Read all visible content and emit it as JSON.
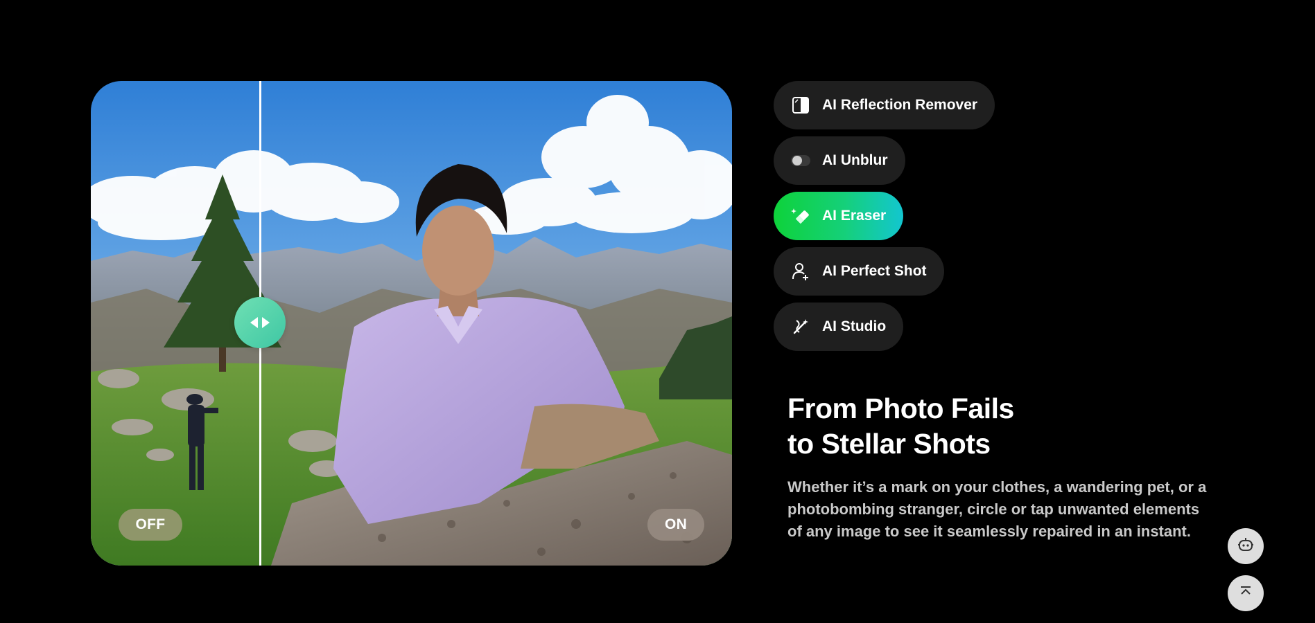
{
  "compare": {
    "off_label": "OFF",
    "on_label": "ON",
    "handle_icon": "left-right-arrows-icon",
    "handle_color": "#4fd3a9"
  },
  "features": [
    {
      "label": "AI Reflection Remover",
      "icon": "reflection-remover-icon",
      "active": false
    },
    {
      "label": "AI Unblur",
      "icon": "unblur-toggle-icon",
      "active": false
    },
    {
      "label": "AI Eraser",
      "icon": "eraser-icon",
      "active": true
    },
    {
      "label": "AI Perfect Shot",
      "icon": "person-plus-icon",
      "active": false
    },
    {
      "label": "AI Studio",
      "icon": "studio-wand-icon",
      "active": false
    }
  ],
  "headline": {
    "line1": "From Photo Fails",
    "line2": "to Stellar Shots"
  },
  "description": "Whether it’s a mark on your clothes, a wandering pet, or a photobombing stranger, circle or tap unwanted elements of any image to see it seamlessly repaired in an instant.",
  "colors": {
    "background": "#000000",
    "pill_bg": "#1f1f1f",
    "active_gradient_start": "#0ed23a",
    "active_gradient_end": "#13c6d0"
  },
  "floating_buttons": {
    "assistant_icon": "robot-assistant-icon",
    "back_to_top_icon": "back-to-top-icon"
  }
}
